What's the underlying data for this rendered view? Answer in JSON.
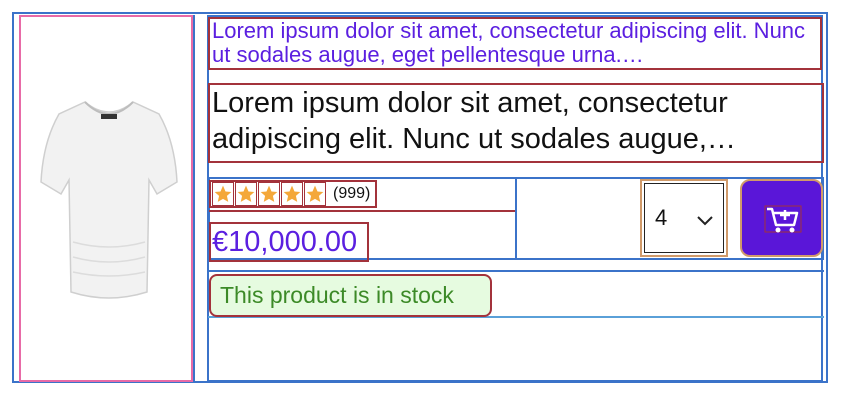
{
  "product": {
    "image_alt": "t-shirt",
    "title": "Lorem ipsum dolor sit amet, consectetur adipiscing elit. Nunc ut sodales augue, eget pellentesque urna.…",
    "description": "Lorem ipsum dolor sit amet, consectetur adipiscing elit. Nunc ut sodales augue,…",
    "rating": 5,
    "rating_max": 5,
    "review_count": "(999)",
    "price": "€10,000.00",
    "quantity": "4",
    "stock_status": "This product is in stock"
  },
  "icons": {
    "star": "star-icon",
    "chevron": "chevron-down-icon",
    "cart": "add-to-cart-icon"
  },
  "colors": {
    "accent": "#5a16d8",
    "link": "#5b1fe0",
    "star": "#f4a83a",
    "stock_bg": "#e6fbe0",
    "stock_text": "#3c8a27"
  }
}
